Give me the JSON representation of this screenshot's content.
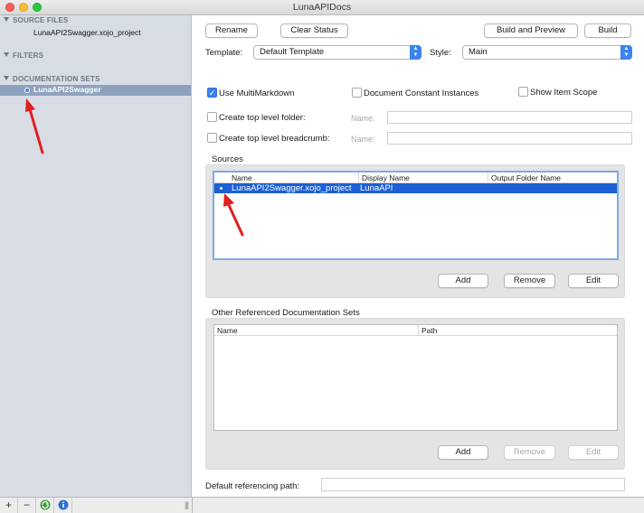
{
  "window": {
    "title": "LunaAPIDocs"
  },
  "sidebar": {
    "sections": [
      {
        "title": "SOURCE FILES",
        "items": [
          "LunaAPI2Swagger.xojo_project"
        ]
      },
      {
        "title": "FILTERS",
        "items": []
      },
      {
        "title": "DOCUMENTATION SETS",
        "items": [
          "LunaAPI2Swagger"
        ]
      }
    ],
    "bottom_buttons": {
      "add": "+",
      "remove": "−",
      "grip": "|||"
    }
  },
  "toolbar": {
    "rename": "Rename",
    "clear_status": "Clear Status",
    "build_and_preview": "Build and Preview",
    "build": "Build"
  },
  "template": {
    "label": "Template:",
    "value": "Default Template"
  },
  "style": {
    "label": "Style:",
    "value": "Main"
  },
  "options": {
    "use_multimarkdown": {
      "label": "Use MultiMarkdown",
      "checked": true
    },
    "document_constant_instances": {
      "label": "Document Constant Instances",
      "checked": false
    },
    "show_item_scope": {
      "label": "Show Item Scope",
      "checked": false
    },
    "create_top_level_folder": {
      "label": "Create top level folder:",
      "checked": false,
      "name_label": "Name:"
    },
    "create_top_level_breadcrumb": {
      "label": "Create top level breadcrumb:",
      "checked": false,
      "name_label": "Name:"
    }
  },
  "sources": {
    "title": "Sources",
    "columns": [
      "Name",
      "Display Name",
      "Output Folder Name"
    ],
    "rows": [
      {
        "name": "LunaAPI2Swagger.xojo_project",
        "display_name": "LunaAPI",
        "output_folder": ""
      }
    ],
    "buttons": {
      "add": "Add",
      "remove": "Remove",
      "edit": "Edit"
    }
  },
  "other_sets": {
    "title": "Other Referenced Documentation Sets",
    "columns": [
      "Name",
      "Path"
    ],
    "rows": [],
    "buttons": {
      "add": "Add",
      "remove": "Remove",
      "edit": "Edit"
    }
  },
  "default_referencing_path": {
    "label": "Default referencing path:",
    "value": ""
  },
  "colors": {
    "accent": "#3b84f0",
    "selection": "#1c5fd6",
    "sidebar": "#d8dde5",
    "annotation_arrow": "#e02020"
  }
}
